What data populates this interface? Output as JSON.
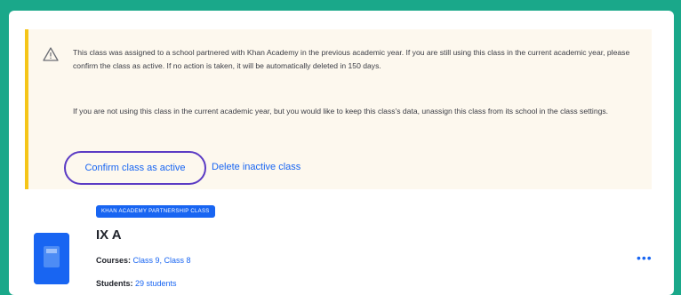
{
  "notice": {
    "icon": "warning-triangle-icon",
    "paragraph1": "This class was assigned to a school partnered with Khan Academy in the previous academic year. If you are still using this class in the current academic year, please confirm the class as active. If no action is taken, it will be automatically deleted in 150 days.",
    "paragraph2": "If you are not using this class in the current academic year, but you would like to keep this class's data, unassign this class from its school in the class settings.",
    "confirm_label": "Confirm class as active",
    "delete_label": "Delete inactive class"
  },
  "class": {
    "badge": "KHAN ACADEMY PARTNERSHIP CLASS",
    "name": "IX A",
    "courses_key": "Courses:",
    "courses_value": "Class 9, Class 8",
    "students_key": "Students:",
    "students_value": "29 students",
    "more_label": "•••"
  },
  "colors": {
    "accent": "#1865f2",
    "warning": "#f5c518",
    "focus": "#5b3bc4",
    "frame": "#1aa88a"
  }
}
